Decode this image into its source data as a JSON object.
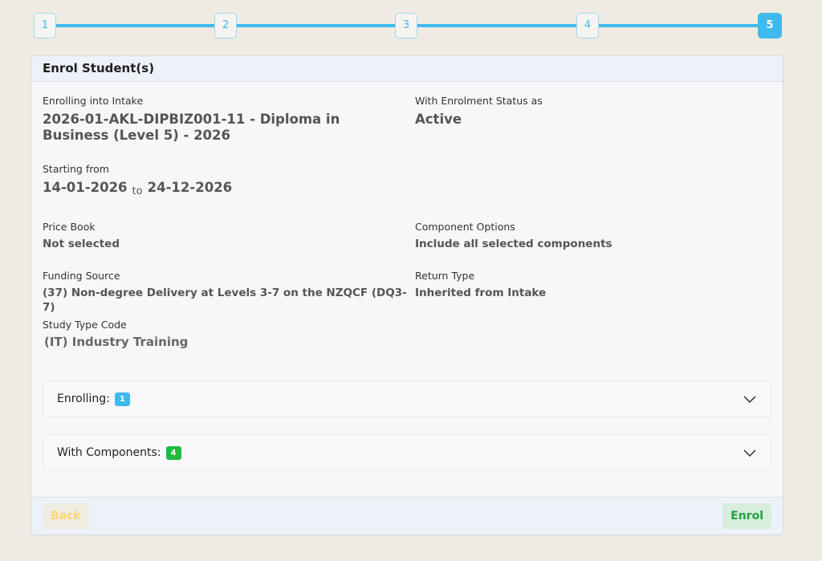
{
  "stepper": {
    "steps": [
      "1",
      "2",
      "3",
      "4",
      "5"
    ],
    "active_step": "5"
  },
  "card": {
    "title": "Enrol Student(s)"
  },
  "intake": {
    "label": "Enrolling into Intake",
    "value": "2026-01-AKL-DIPBIZ001-11 - Diploma in Business (Level 5) - 2026"
  },
  "status": {
    "label": "With Enrolment Status as",
    "value": "Active"
  },
  "dates": {
    "label": "Starting from",
    "start": "14-01-2026",
    "separator": "to",
    "end": "24-12-2026"
  },
  "price_book": {
    "label": "Price Book",
    "value": "Not selected"
  },
  "component_options": {
    "label": "Component Options",
    "value": "Include all selected components"
  },
  "funding_source": {
    "label": "Funding Source",
    "value": "(37) Non-degree Delivery at Levels 3-7 on the NZQCF (DQ3-7)"
  },
  "return_type": {
    "label": "Return Type",
    "value": "Inherited from Intake"
  },
  "study_type": {
    "label": "Study Type Code",
    "value": "(IT) Industry Training"
  },
  "accordions": {
    "enrolling": {
      "label": "Enrolling:",
      "count": "1",
      "icon": "chevron-down-icon"
    },
    "components": {
      "label": "With Components:",
      "count": "4",
      "icon": "chevron-down-icon"
    }
  },
  "footer": {
    "back_label": "Back",
    "enrol_label": "Enrol"
  },
  "colors": {
    "accent": "#3ebaec",
    "success": "#1fbb3f",
    "background": "#efebe3"
  }
}
